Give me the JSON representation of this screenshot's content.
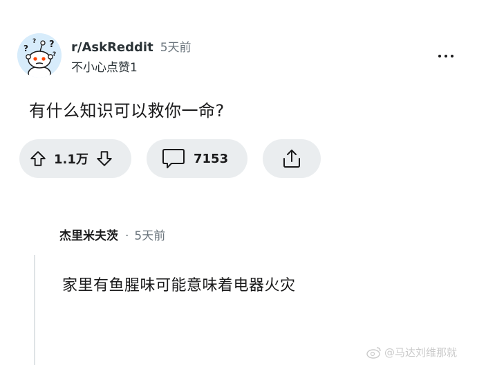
{
  "post": {
    "subreddit": "r/AskReddit",
    "time": "5天前",
    "subtitle": "不小心点赞1",
    "title": "有什么知识可以救你一命?"
  },
  "actions": {
    "upvote_icon": "arrow-up-icon",
    "vote_count": "1.1万",
    "downvote_icon": "arrow-down-icon",
    "comment_icon": "comment-bubble-icon",
    "comment_count": "7153",
    "share_icon": "share-icon"
  },
  "comment": {
    "author": "杰里米夫茨",
    "separator": "·",
    "time": "5天前",
    "body": "家里有鱼腥味可能意味着电器火灾"
  },
  "watermark": {
    "icon": "weibo-icon",
    "text": "@马达刘维那就"
  },
  "colors": {
    "pill_bg": "#eaedef",
    "text": "#1a1a1b",
    "muted": "#6b757d",
    "avatar_bg": "#d7ecfb"
  }
}
